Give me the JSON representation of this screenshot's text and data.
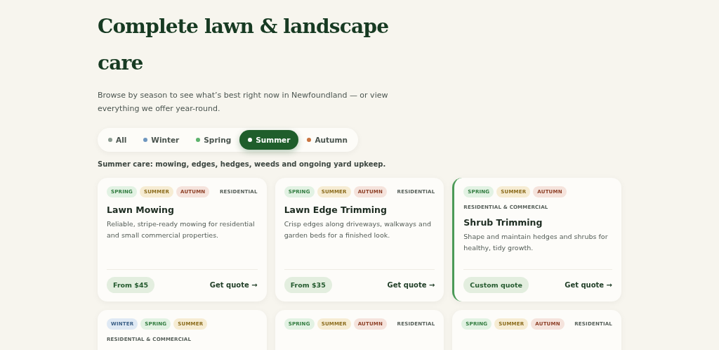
{
  "heading": "Complete lawn & landscape care",
  "intro": "Browse by season to see what’s best right now in Newfoundland — or view everything we offer year-round.",
  "filters": [
    {
      "label": "All",
      "color": "#8a9a8f",
      "selected": false
    },
    {
      "label": "Winter",
      "color": "#6f97bf",
      "selected": false
    },
    {
      "label": "Spring",
      "color": "#5db36d",
      "selected": false
    },
    {
      "label": "Summer",
      "color": "#ffffff",
      "selected": true
    },
    {
      "label": "Autumn",
      "color": "#c9743f",
      "selected": false
    }
  ],
  "filter_note": "Summer care: mowing, edges, hedges, weeds and ongoing yard upkeep.",
  "cards": [
    {
      "tags": [
        {
          "label": "SPRING",
          "kind": "spring"
        },
        {
          "label": "SUMMER",
          "kind": "summer"
        },
        {
          "label": "AUTUMN",
          "kind": "autumn"
        }
      ],
      "audience": "RESIDENTIAL",
      "title": "Lawn Mowing",
      "description": "Reliable, stripe-ready mowing for residential and small commercial properties.",
      "price": "From $45",
      "action": "Get quote →",
      "highlighted": false
    },
    {
      "tags": [
        {
          "label": "SPRING",
          "kind": "spring"
        },
        {
          "label": "SUMMER",
          "kind": "summer"
        },
        {
          "label": "AUTUMN",
          "kind": "autumn"
        }
      ],
      "audience": "RESIDENTIAL",
      "title": "Lawn Edge Trimming",
      "description": "Crisp edges along driveways, walkways and garden beds for a finished look.",
      "price": "From $35",
      "action": "Get quote →",
      "highlighted": false
    },
    {
      "tags": [
        {
          "label": "SPRING",
          "kind": "spring"
        },
        {
          "label": "SUMMER",
          "kind": "summer"
        },
        {
          "label": "AUTUMN",
          "kind": "autumn"
        }
      ],
      "audience": "RESIDENTIAL & COMMERCIAL",
      "title": "Shrub Trimming",
      "description": "Shape and maintain hedges and shrubs for healthy, tidy growth.",
      "price": "Custom quote",
      "action": "Get quote →",
      "highlighted": true
    },
    {
      "tags": [
        {
          "label": "WINTER",
          "kind": "winter"
        },
        {
          "label": "SPRING",
          "kind": "spring"
        },
        {
          "label": "SUMMER",
          "kind": "summer"
        }
      ],
      "audience": "RESIDENTIAL & COMMERCIAL",
      "highlighted": false
    },
    {
      "tags": [
        {
          "label": "SPRING",
          "kind": "spring"
        },
        {
          "label": "SUMMER",
          "kind": "summer"
        },
        {
          "label": "AUTUMN",
          "kind": "autumn"
        }
      ],
      "audience": "RESIDENTIAL",
      "highlighted": false
    },
    {
      "tags": [
        {
          "label": "SPRING",
          "kind": "spring"
        },
        {
          "label": "SUMMER",
          "kind": "summer"
        },
        {
          "label": "AUTUMN",
          "kind": "autumn"
        }
      ],
      "audience": "RESIDENTIAL",
      "highlighted": false
    }
  ]
}
